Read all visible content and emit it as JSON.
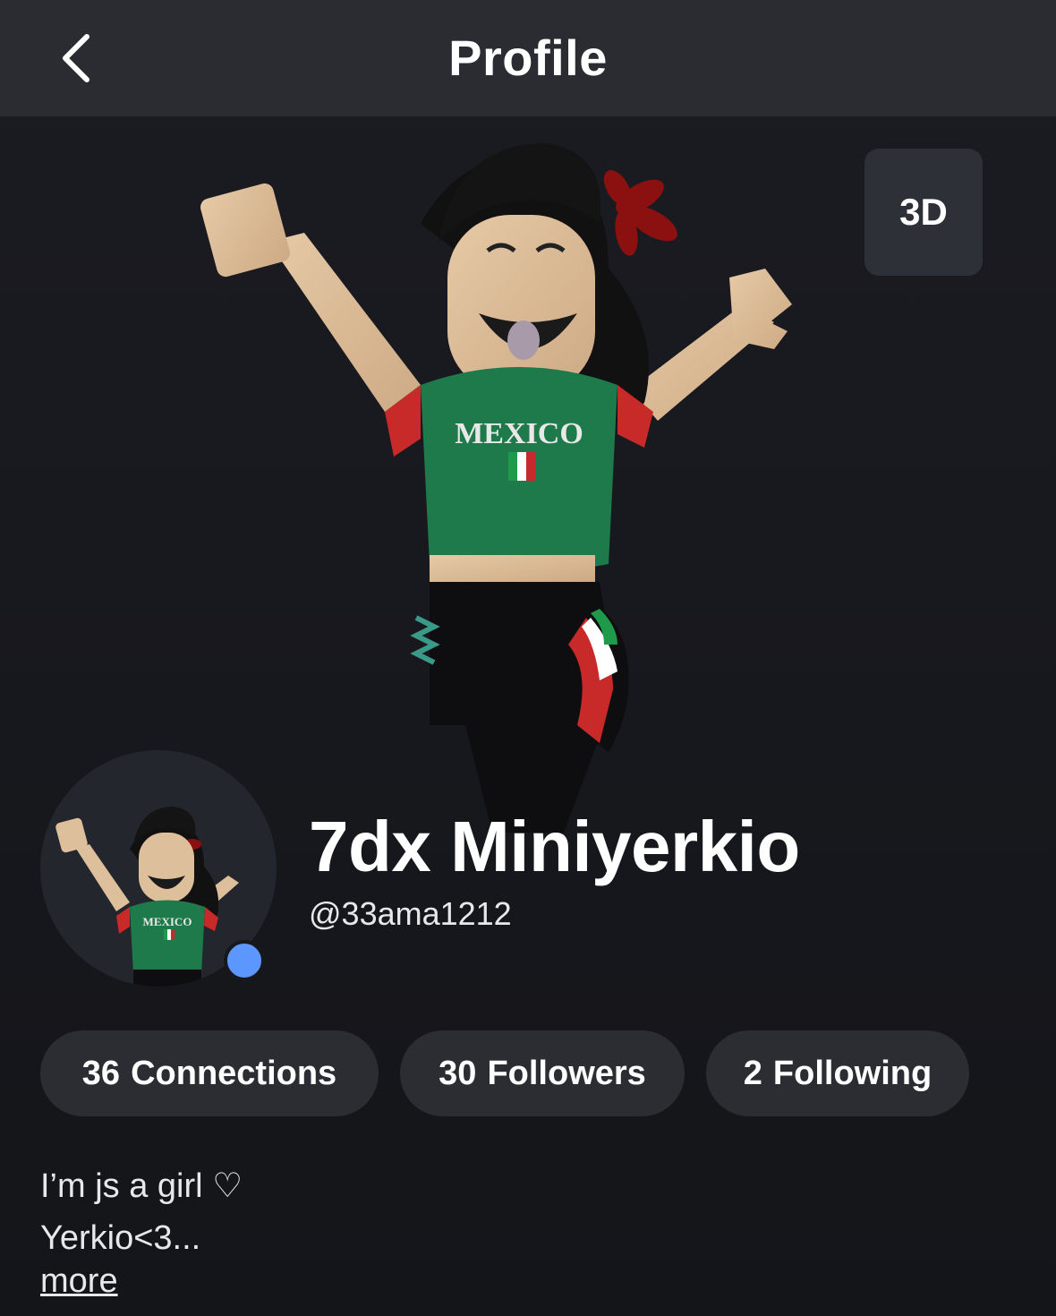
{
  "header": {
    "title": "Profile",
    "back_icon": "chevron-left-icon"
  },
  "stage": {
    "view_toggle_label": "3D"
  },
  "profile": {
    "display_name": "7dx Miniyerkio",
    "username": "@33ama1212",
    "presence_color": "#5c97ff"
  },
  "stats": [
    {
      "count": "36",
      "label": "Connections"
    },
    {
      "count": "30",
      "label": "Followers"
    },
    {
      "count": "2",
      "label": "Following"
    }
  ],
  "bio": {
    "line1": "I’m js a girl ♡",
    "line2": "Yerkio<3...",
    "more_label": "more"
  },
  "avatar": {
    "shirt_text": "MEXICO"
  }
}
